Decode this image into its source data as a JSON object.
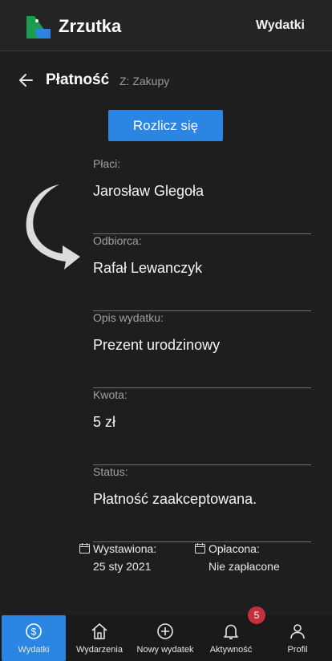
{
  "header": {
    "app_title": "Zrzutka",
    "top_link": "Wydatki",
    "logo_colors": [
      "#1b9e4b",
      "#2b86e3"
    ]
  },
  "page": {
    "title": "Płatność",
    "subtitle": "Z: Zakupy",
    "action_label": "Rozlicz się"
  },
  "fields": [
    {
      "label": "Płaci:",
      "value": "Jarosław Glegoła"
    },
    {
      "label": "Odbiorca:",
      "value": "Rafał Lewanczyk"
    },
    {
      "label": "Opis wydatku:",
      "value": "Prezent urodzinowy"
    },
    {
      "label": "Kwota:",
      "value": "5 zł"
    },
    {
      "label": "Status:",
      "value": "Płatność zaakceptowana."
    }
  ],
  "dates": {
    "issued_label": "Wystawiona:",
    "issued_value": "25 sty 2021",
    "paid_label": "Opłacona:",
    "paid_value": "Nie zapłacone"
  },
  "nav": {
    "items": [
      {
        "label": "Wydatki",
        "icon": "dollar-circle-icon",
        "active": true
      },
      {
        "label": "Wydarzenia",
        "icon": "home-icon"
      },
      {
        "label": "Nowy wydatek",
        "icon": "plus-circle-icon"
      },
      {
        "label": "Aktywność",
        "icon": "bell-icon"
      },
      {
        "label": "Profil",
        "icon": "user-icon"
      }
    ],
    "badge_count": "5"
  },
  "colors": {
    "accent": "#2b86e3",
    "badge": "#c4303d",
    "background": "#1e1e1e"
  }
}
